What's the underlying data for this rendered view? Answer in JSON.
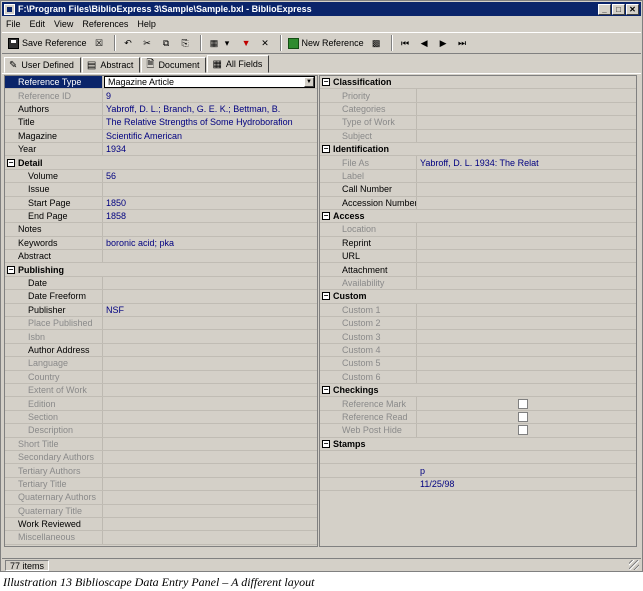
{
  "window": {
    "title": "F:\\Program Files\\BiblioExpress 3\\Sample\\Sample.bxl - BiblioExpress",
    "buttons": [
      "_",
      "□",
      "✕"
    ]
  },
  "menu": [
    "File",
    "Edit",
    "View",
    "References",
    "Help"
  ],
  "toolbar": {
    "save_reference": "Save Reference",
    "new_reference": "New Reference"
  },
  "tabs": [
    "User Defined",
    "Abstract",
    "Document",
    "All Fields"
  ],
  "left_rows": [
    {
      "kind": "field",
      "label": "Reference Type",
      "value": "Magazine Article",
      "selected": true
    },
    {
      "kind": "field",
      "label": "Reference ID",
      "value": "9",
      "dim": true
    },
    {
      "kind": "field",
      "label": "Authors",
      "value": "Yabroff, D. L.; Branch, G. E. K.; Bettman, B."
    },
    {
      "kind": "field",
      "label": "Title",
      "value": "The Relative Strengths of Some Hydroborafion"
    },
    {
      "kind": "field",
      "label": "Magazine",
      "value": "Scientific American"
    },
    {
      "kind": "field",
      "label": "Year",
      "value": "1934"
    },
    {
      "kind": "cat",
      "label": "Detail"
    },
    {
      "kind": "field",
      "label": "Volume",
      "value": "56",
      "sub": true
    },
    {
      "kind": "field",
      "label": "Issue",
      "value": "",
      "sub": true
    },
    {
      "kind": "field",
      "label": "Start Page",
      "value": "1850",
      "sub": true
    },
    {
      "kind": "field",
      "label": "End Page",
      "value": "1858",
      "sub": true
    },
    {
      "kind": "field",
      "label": "Notes",
      "value": ""
    },
    {
      "kind": "field",
      "label": "Keywords",
      "value": "boronic acid; pka"
    },
    {
      "kind": "field",
      "label": "Abstract",
      "value": ""
    },
    {
      "kind": "cat",
      "label": "Publishing"
    },
    {
      "kind": "field",
      "label": "Date",
      "value": "",
      "sub": true
    },
    {
      "kind": "field",
      "label": "Date Freeform",
      "value": "",
      "sub": true
    },
    {
      "kind": "field",
      "label": "Publisher",
      "value": "NSF",
      "sub": true
    },
    {
      "kind": "field",
      "label": "Place Published",
      "value": "",
      "sub": true,
      "dim": true
    },
    {
      "kind": "field",
      "label": "Isbn",
      "value": "",
      "sub": true,
      "dim": true
    },
    {
      "kind": "field",
      "label": "Author Address",
      "value": "",
      "sub": true
    },
    {
      "kind": "field",
      "label": "Language",
      "value": "",
      "sub": true,
      "dim": true
    },
    {
      "kind": "field",
      "label": "Country",
      "value": "",
      "sub": true,
      "dim": true
    },
    {
      "kind": "field",
      "label": "Extent of Work",
      "value": "",
      "sub": true,
      "dim": true
    },
    {
      "kind": "field",
      "label": "Edition",
      "value": "",
      "sub": true,
      "dim": true
    },
    {
      "kind": "field",
      "label": "Section",
      "value": "",
      "sub": true,
      "dim": true
    },
    {
      "kind": "field",
      "label": "Description",
      "value": "",
      "sub": true,
      "dim": true
    },
    {
      "kind": "field",
      "label": "Short Title",
      "value": "",
      "dim": true
    },
    {
      "kind": "field",
      "label": "Secondary Authors",
      "value": "",
      "dim": true
    },
    {
      "kind": "field",
      "label": "Tertiary Authors",
      "value": "",
      "dim": true
    },
    {
      "kind": "field",
      "label": "Tertiary Title",
      "value": "",
      "dim": true
    },
    {
      "kind": "field",
      "label": "Quaternary Authors",
      "value": "",
      "dim": true
    },
    {
      "kind": "field",
      "label": "Quaternary Title",
      "value": "",
      "dim": true
    },
    {
      "kind": "field",
      "label": "Work Reviewed",
      "value": ""
    },
    {
      "kind": "field",
      "label": "Miscellaneous",
      "value": "",
      "dim": true
    }
  ],
  "right_rows": [
    {
      "kind": "cat",
      "label": "Classification"
    },
    {
      "kind": "field",
      "label": "Priority",
      "value": "",
      "dim": true
    },
    {
      "kind": "field",
      "label": "Categories",
      "value": "",
      "dim": true
    },
    {
      "kind": "field",
      "label": "Type of Work",
      "value": "",
      "dim": true
    },
    {
      "kind": "field",
      "label": "Subject",
      "value": "",
      "dim": true
    },
    {
      "kind": "cat",
      "label": "Identification"
    },
    {
      "kind": "field",
      "label": "File As",
      "value": "Yabroff, D. L. 1934: The Relat",
      "dim": true
    },
    {
      "kind": "field",
      "label": "Label",
      "value": "",
      "dim": true
    },
    {
      "kind": "field",
      "label": "Call Number",
      "value": ""
    },
    {
      "kind": "field",
      "label": "Accession Number",
      "value": ""
    },
    {
      "kind": "cat",
      "label": "Access"
    },
    {
      "kind": "field",
      "label": "Location",
      "value": "",
      "dim": true
    },
    {
      "kind": "field",
      "label": "Reprint",
      "value": ""
    },
    {
      "kind": "field",
      "label": "URL",
      "value": ""
    },
    {
      "kind": "field",
      "label": "Attachment",
      "value": ""
    },
    {
      "kind": "field",
      "label": "Availability",
      "value": "",
      "dim": true
    },
    {
      "kind": "cat",
      "label": "Custom"
    },
    {
      "kind": "field",
      "label": "Custom 1",
      "value": "",
      "dim": true
    },
    {
      "kind": "field",
      "label": "Custom 2",
      "value": "",
      "dim": true
    },
    {
      "kind": "field",
      "label": "Custom 3",
      "value": "",
      "dim": true
    },
    {
      "kind": "field",
      "label": "Custom 4",
      "value": "",
      "dim": true
    },
    {
      "kind": "field",
      "label": "Custom 5",
      "value": "",
      "dim": true
    },
    {
      "kind": "field",
      "label": "Custom 6",
      "value": "",
      "dim": true
    },
    {
      "kind": "cat",
      "label": "Checkings"
    },
    {
      "kind": "check",
      "label": "Reference Mark",
      "dim": true
    },
    {
      "kind": "check",
      "label": "Reference Read",
      "dim": true
    },
    {
      "kind": "check",
      "label": "Web Post Hide",
      "dim": true
    },
    {
      "kind": "cat",
      "label": "Stamps"
    },
    {
      "kind": "plain",
      "value": ""
    },
    {
      "kind": "plain",
      "value": "p"
    },
    {
      "kind": "plain",
      "value": "11/25/98"
    }
  ],
  "status": {
    "items": "77 items"
  },
  "caption": "Illustration 13 Biblioscape Data Entry Panel – A different layout"
}
